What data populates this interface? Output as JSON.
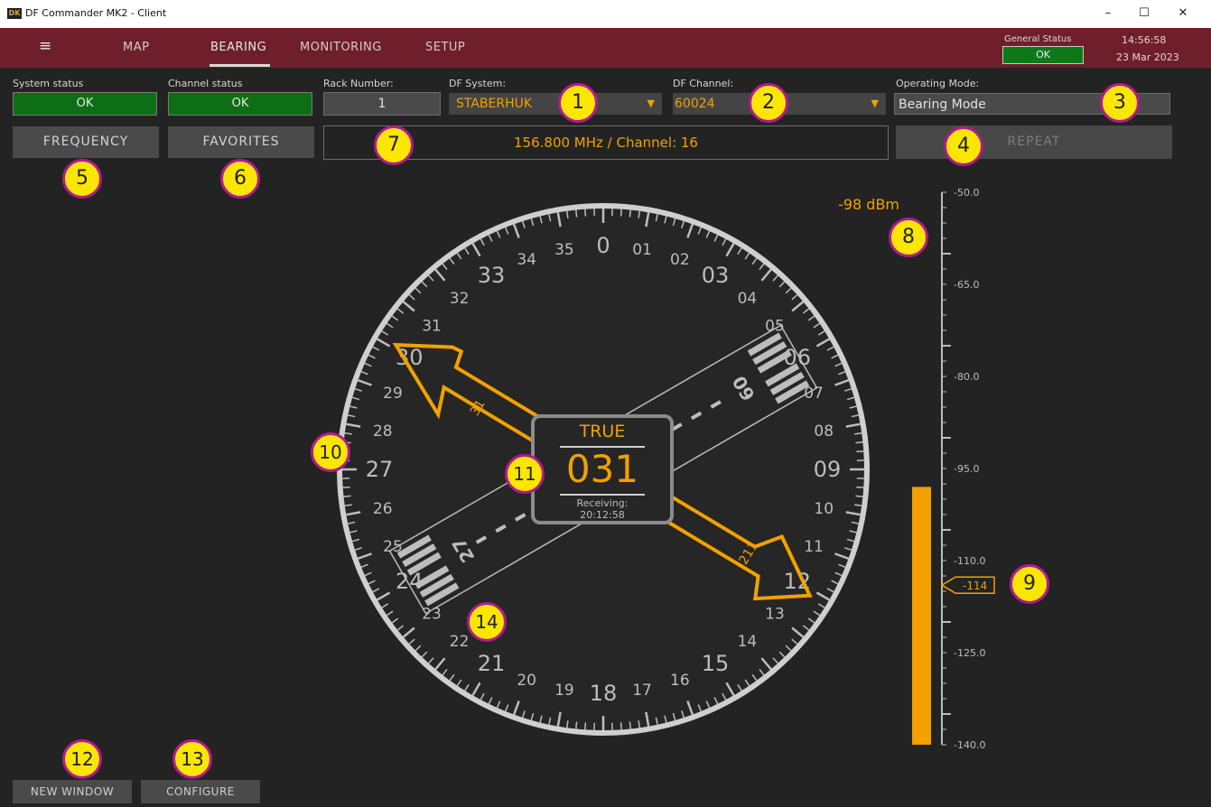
{
  "window": {
    "title": "DF Commander MK2 - Client",
    "logo_text": "DK",
    "minimize": "–",
    "maximize": "☐",
    "close": "✕"
  },
  "nav": {
    "menu_icon": "≡",
    "tabs": [
      {
        "label": "MAP",
        "active": false
      },
      {
        "label": "BEARING",
        "active": true
      },
      {
        "label": "MONITORING",
        "active": false
      },
      {
        "label": "SETUP",
        "active": false
      }
    ],
    "general_status_label": "General Status",
    "general_status_value": "OK",
    "time": "14:56:58",
    "date": "23 Mar 2023"
  },
  "controls": {
    "system_status_label": "System status",
    "system_status_value": "OK",
    "channel_status_label": "Channel status",
    "channel_status_value": "OK",
    "rack_number_label": "Rack Number:",
    "rack_number_value": "1",
    "df_system_label": "DF System:",
    "df_system_value": "STABERHUK",
    "df_channel_label": "DF Channel:",
    "df_channel_value": "60024",
    "operating_mode_label": "Operating Mode:",
    "operating_mode_value": "Bearing Mode",
    "frequency_button": "FREQUENCY",
    "favorites_button": "FAVORITES",
    "frequency_display": "156.800 MHz / Channel: 16",
    "repeat_button": "REPEAT",
    "dropdown_icon": "▼"
  },
  "compass": {
    "reference": "TRUE",
    "bearing": "031",
    "receiving_label": "Receiving:",
    "receiving_time": "20:12:58",
    "bearing_deg": 31,
    "reciprocal_label": "211",
    "head_label": "31",
    "runway_label_top": "27",
    "runway_label_bottom": "09",
    "dial_labels": [
      "0",
      "01",
      "02",
      "03",
      "04",
      "05",
      "06",
      "07",
      "08",
      "09",
      "10",
      "11",
      "12",
      "13",
      "14",
      "15",
      "16",
      "17",
      "18",
      "19",
      "20",
      "21",
      "22",
      "23",
      "24",
      "25",
      "26",
      "27",
      "28",
      "29",
      "30",
      "31",
      "32",
      "33",
      "34",
      "35"
    ]
  },
  "signal": {
    "level_text": "-98 dBm",
    "level_value": -98,
    "threshold_value": -114,
    "threshold_text": "-114",
    "scale_min": -140,
    "scale_max": -50,
    "scale_labels": [
      "-50.0",
      "-65.0",
      "-80.0",
      "-95.0",
      "-110.0",
      "-125.0",
      "-140.0"
    ]
  },
  "bottom": {
    "new_window_button": "NEW WINDOW",
    "configure_button": "CONFIGURE"
  },
  "callouts": [
    "1",
    "2",
    "3",
    "4",
    "5",
    "6",
    "7",
    "8",
    "9",
    "10",
    "11",
    "12",
    "13",
    "14"
  ],
  "colors": {
    "accent": "#f2a100",
    "navbar": "#6e1f2b",
    "status_ok": "#0d7a17",
    "callout_fill": "#fbe600",
    "callout_border": "#b21b8f"
  }
}
